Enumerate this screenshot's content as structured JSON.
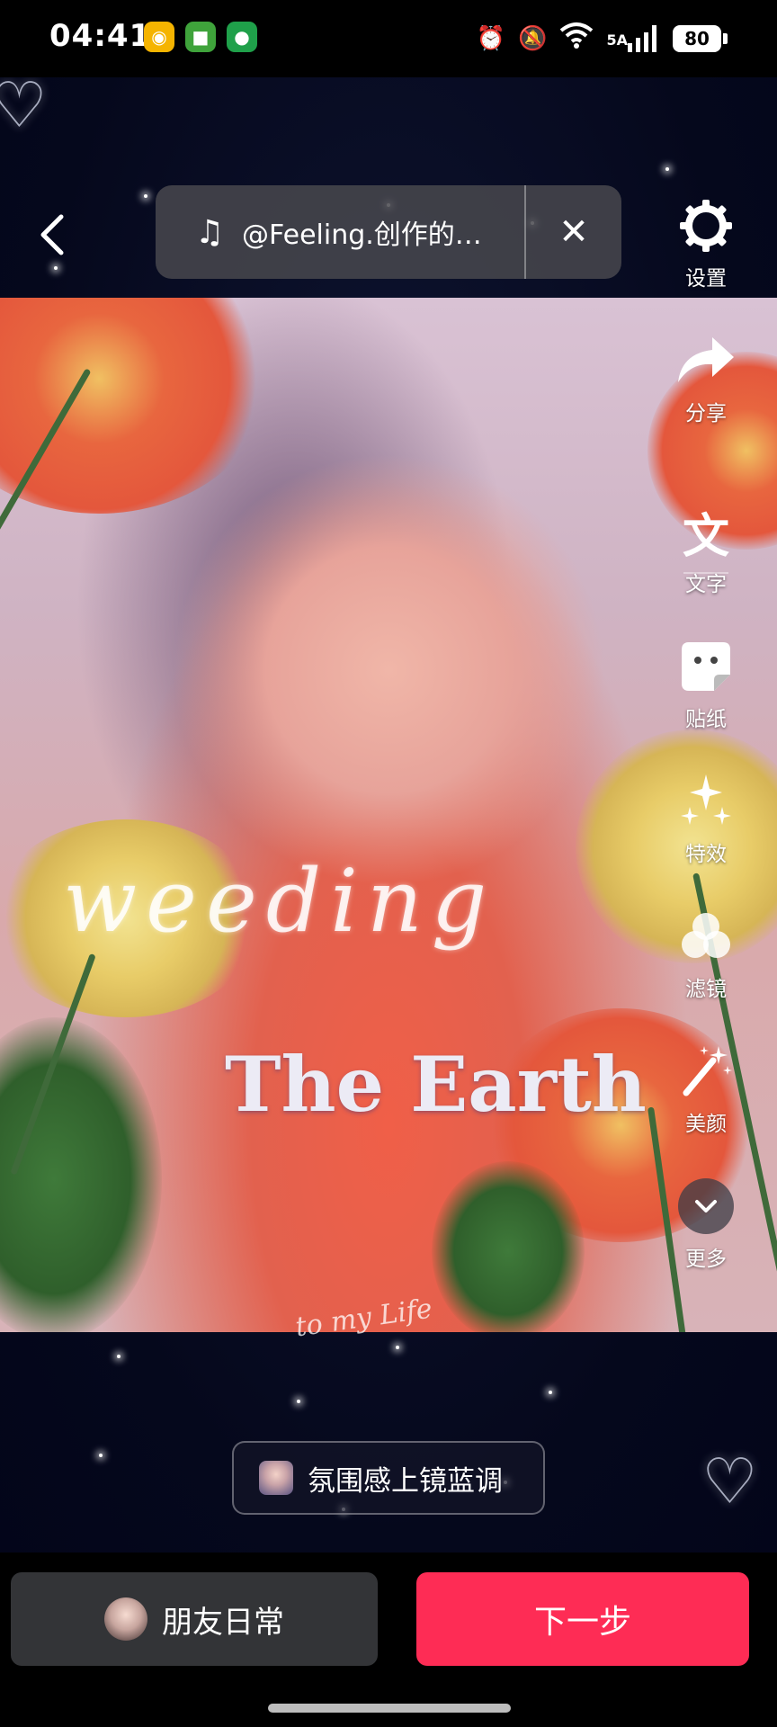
{
  "status_bar": {
    "time": "04:41",
    "network_label": "5A",
    "battery_level": "80",
    "app_icons": [
      "weibo-icon",
      "sticker-app-icon",
      "music-app-icon"
    ],
    "system_icons": [
      "alarm-icon",
      "mute-icon",
      "wifi-icon",
      "signal-icon",
      "battery-icon"
    ]
  },
  "top": {
    "music_title": "@Feeling.创作的…"
  },
  "tools": [
    {
      "id": "settings",
      "label": "设置",
      "icon": "gear-icon"
    },
    {
      "id": "share",
      "label": "分享",
      "icon": "share-arrow-icon"
    },
    {
      "id": "text",
      "label": "文字",
      "icon": "text-icon"
    },
    {
      "id": "stickers",
      "label": "贴纸",
      "icon": "sticker-icon"
    },
    {
      "id": "effects",
      "label": "特效",
      "icon": "sparkle-icon"
    },
    {
      "id": "filters",
      "label": "滤镜",
      "icon": "filter-icon"
    },
    {
      "id": "beauty",
      "label": "美颜",
      "icon": "magic-wand-icon"
    },
    {
      "id": "more",
      "label": "更多",
      "icon": "chevron-down-icon"
    }
  ],
  "overlay_text": {
    "script_word": "weeding",
    "title": "The Earth",
    "caption": "to my Life"
  },
  "effect_chip": {
    "label": "氛围感上镜蓝调"
  },
  "bottom": {
    "friends_label": "朋友日常",
    "next_label": "下一步"
  },
  "colors": {
    "next_button": "#fe2c55",
    "friends_button": "#333437",
    "background": "#05081c"
  }
}
